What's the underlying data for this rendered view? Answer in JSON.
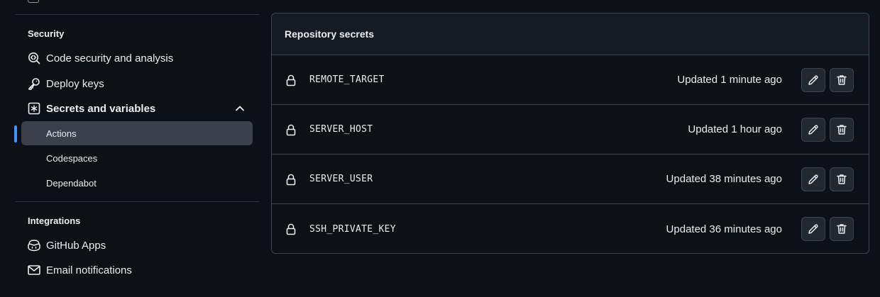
{
  "sidebar": {
    "security_header": "Security",
    "integrations_header": "Integrations",
    "items": [
      {
        "label": "Code security and analysis",
        "icon": "codescan-icon"
      },
      {
        "label": "Deploy keys",
        "icon": "key-icon"
      },
      {
        "label": "Secrets and variables",
        "icon": "asterisk-box-icon",
        "expanded": true
      }
    ],
    "subitems": [
      {
        "label": "Actions",
        "active": true
      },
      {
        "label": "Codespaces",
        "active": false
      },
      {
        "label": "Dependabot",
        "active": false
      }
    ],
    "integrations": [
      {
        "label": "GitHub Apps",
        "icon": "copilot-icon"
      },
      {
        "label": "Email notifications",
        "icon": "mail-icon"
      }
    ]
  },
  "secrets_panel": {
    "title": "Repository secrets",
    "rows": [
      {
        "name": "REMOTE_TARGET",
        "updated": "Updated 1 minute ago"
      },
      {
        "name": "SERVER_HOST",
        "updated": "Updated 1 hour ago"
      },
      {
        "name": "SERVER_USER",
        "updated": "Updated 38 minutes ago"
      },
      {
        "name": "SSH_PRIVATE_KEY",
        "updated": "Updated 36 minutes ago"
      }
    ],
    "icons": {
      "lock": "lock-icon",
      "edit": "pencil-icon",
      "delete": "trash-icon"
    }
  },
  "colors": {
    "background": "#0d1117",
    "accent": "#4493f8",
    "border": "#3d444d",
    "active_bg": "#3a414a"
  }
}
